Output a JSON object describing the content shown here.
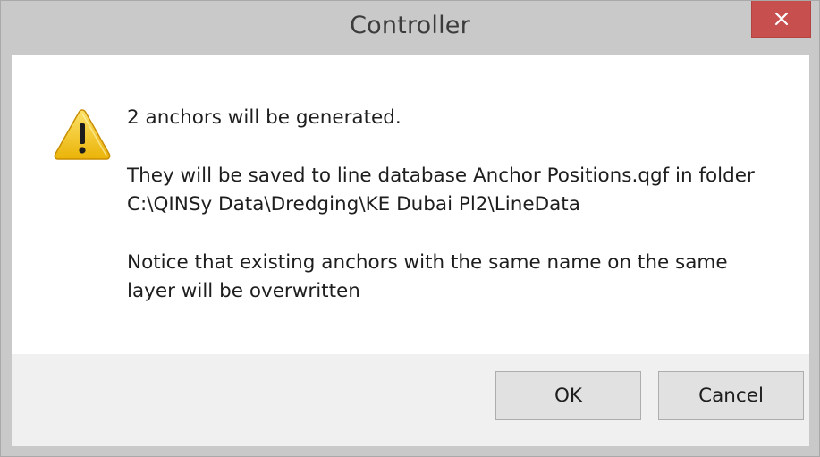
{
  "window": {
    "title": "Controller"
  },
  "icons": {
    "close": "close-icon",
    "warning": "warning-icon"
  },
  "message": {
    "line1": "2 anchors will be generated.",
    "line2": "They will be saved to line database Anchor Positions.qgf in folder",
    "line3": "C:\\QINSy Data\\Dredging\\KE Dubai Pl2\\LineData",
    "line4": "Notice that existing anchors with the same name on the same",
    "line5": "layer will be overwritten"
  },
  "buttons": {
    "ok": "OK",
    "cancel": "Cancel"
  },
  "colors": {
    "close_button": "#c7504f",
    "warning_fill": "#f3c511",
    "footer": "#f0f0f0"
  }
}
